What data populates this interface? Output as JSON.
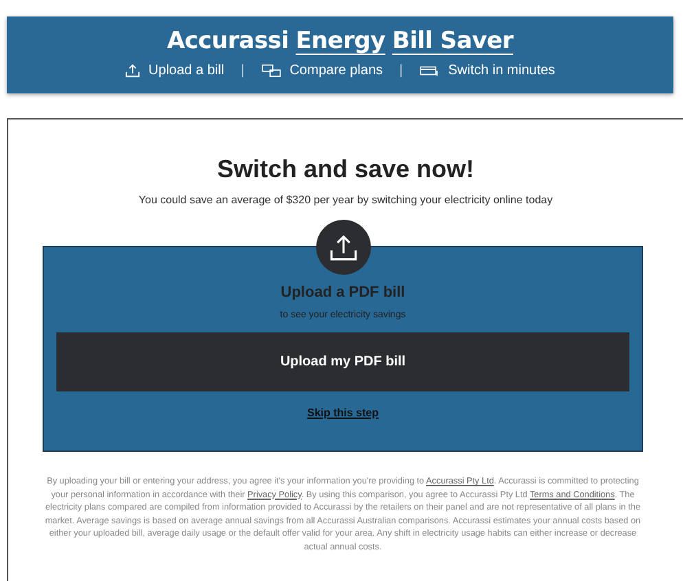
{
  "header": {
    "title_parts": [
      {
        "text": "Accurassi",
        "underlined": false
      },
      {
        "text": "Energy",
        "underlined": true
      },
      {
        "text": "Bill Saver",
        "underlined": true
      }
    ],
    "features": [
      {
        "kind": "upload",
        "label": "Upload a bill"
      },
      {
        "kind": "compare",
        "label": "Compare plans"
      },
      {
        "kind": "switch",
        "label": "Switch in minutes"
      }
    ],
    "separator": "|"
  },
  "main": {
    "heading": "Switch and save now!",
    "subheading": "You could save an average of $320 per year by switching your electricity online today"
  },
  "upload_panel": {
    "title": "Upload a PDF bill",
    "subtitle": "to see your electricity savings",
    "button": "Upload my PDF bill",
    "skip_link": "Skip this step"
  },
  "disclaimer": [
    {
      "text": "By uploading your bill or entering your address, you agree it's your information you're providing to ",
      "link": false
    },
    {
      "text": "Accurassi Pty Ltd",
      "link": true
    },
    {
      "text": ". Accurassi is committed to protecting your personal information in accordance with their ",
      "link": false
    },
    {
      "text": "Privacy Policy",
      "link": true
    },
    {
      "text": ". By using this comparison, you agree to Accurassi Pty Ltd ",
      "link": false
    },
    {
      "text": "Terms and Conditions",
      "link": true
    },
    {
      "text": ". The electricity plans compared are compiled from information provided to Accurassi by the retailers on their panel and are not representative of all plans in the market. Average savings is based on average annual savings from all Accurassi Australian comparisons. Accurassi estimates your annual costs based on either your uploaded bill, average daily usage or the default offer valid for your area. Any shift in electricity usage habits can either increase or decrease actual annual costs.",
      "link": false
    }
  ]
}
